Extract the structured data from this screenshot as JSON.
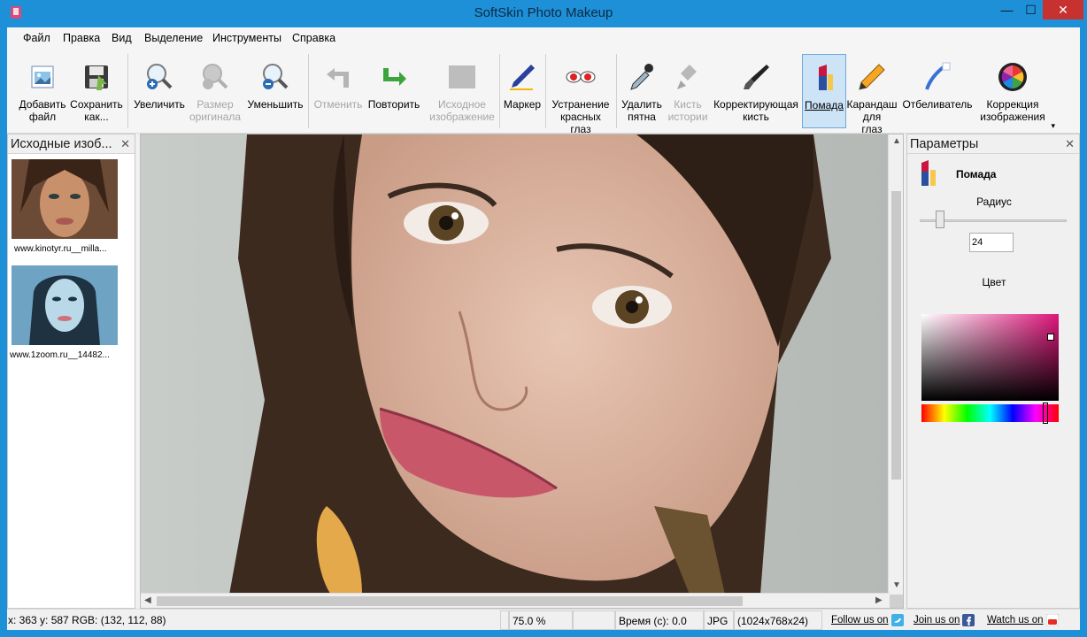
{
  "window": {
    "title": "SoftSkin Photo Makeup",
    "minimize": "—",
    "maximize": "☐",
    "close": "✕"
  },
  "menu": [
    "Файл",
    "Правка",
    "Вид",
    "Выделение",
    "Инструменты",
    "Справка"
  ],
  "toolbar": {
    "add_file": "Добавить\nфайл",
    "save_as": "Сохранить\nкак...",
    "zoom_in": "Увеличить",
    "original_size": "Размер\nоригинала",
    "zoom_out": "Уменьшить",
    "undo": "Отменить",
    "redo": "Повторить",
    "source_image": "Исходное\nизображение",
    "marker": "Маркер",
    "red_eye": "Устранение\nкрасных\nглаз",
    "remove_spots": "Удалить\nпятна",
    "history_brush": "Кисть\nистории",
    "correcting_brush": "Корректирующая\nкисть",
    "lipstick": "Помада",
    "eye_pencil": "Карандаш\nдля\nглаз",
    "whitener": "Отбеливатель",
    "image_correction": "Коррекция\nизображения",
    "more": "▾"
  },
  "left_panel": {
    "title": "Исходные изоб...",
    "close": "✕",
    "thumbnails": [
      {
        "caption": "www.kinotyr.ru__milla..."
      },
      {
        "caption": "www.1zoom.ru__14482..."
      }
    ]
  },
  "right_panel": {
    "title": "Параметры",
    "close": "✕",
    "tool_name": "Помада",
    "radius_label": "Радиус",
    "radius_value": "24",
    "color_label": "Цвет"
  },
  "canvas": {
    "arrow_up": "▲",
    "arrow_down": "▼",
    "arrow_left": "◀",
    "arrow_right": "▶"
  },
  "statusbar": {
    "coords": "x: 363 y: 587  RGB: (132, 112, 88)",
    "zoom": "75.0 %",
    "time": "Время (с): 0.0",
    "format": "JPG",
    "dimensions": "(1024x768x24)",
    "follow": "Follow us on",
    "join": "Join us on",
    "watch": "Watch us on"
  },
  "colors": {
    "title_bar": "#1e90d8",
    "close_button": "#c7312f",
    "selected_color": "#e0167c"
  }
}
